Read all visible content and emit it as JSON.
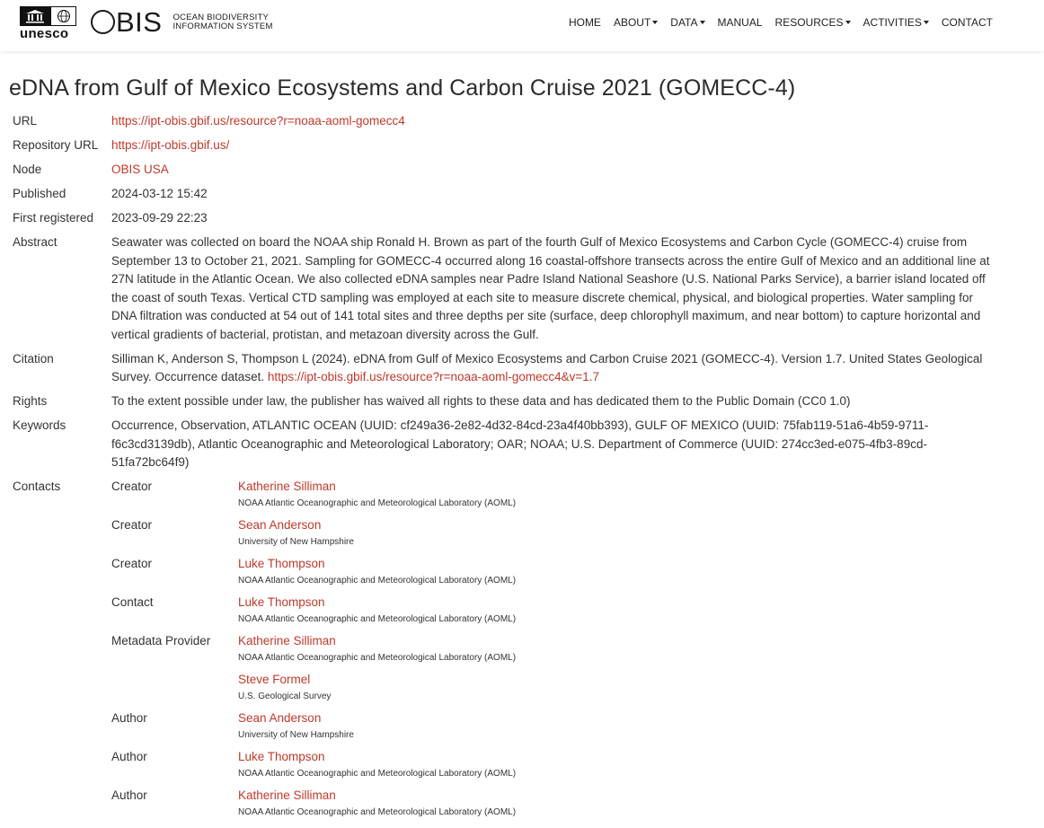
{
  "header": {
    "unesco_word": "unesco",
    "obis_word": "OBIS",
    "obis_sub_line1": "OCEAN BIODIVERSITY",
    "obis_sub_line2": "INFORMATION SYSTEM",
    "nav": [
      {
        "label": "HOME",
        "dropdown": false
      },
      {
        "label": "ABOUT",
        "dropdown": true
      },
      {
        "label": "DATA",
        "dropdown": true
      },
      {
        "label": "MANUAL",
        "dropdown": false
      },
      {
        "label": "RESOURCES",
        "dropdown": true
      },
      {
        "label": "ACTIVITIES",
        "dropdown": true
      },
      {
        "label": "CONTACT",
        "dropdown": false
      }
    ]
  },
  "title": "eDNA from Gulf of Mexico Ecosystems and Carbon Cruise 2021 (GOMECC-4)",
  "fields": {
    "url_label": "URL",
    "url": "https://ipt-obis.gbif.us/resource?r=noaa-aoml-gomecc4",
    "repo_label": "Repository URL",
    "repo": "https://ipt-obis.gbif.us/",
    "node_label": "Node",
    "node": "OBIS USA",
    "published_label": "Published",
    "published": "2024-03-12 15:42",
    "first_label": "First registered",
    "first": "2023-09-29 22:23",
    "abstract_label": "Abstract",
    "abstract": "Seawater was collected on board the NOAA ship Ronald H. Brown as part of the fourth Gulf of Mexico Ecosystems and Carbon Cycle (GOMECC-4) cruise from September 13 to October 21, 2021. Sampling for GOMECC-4 occurred along 16 coastal-offshore transects across the entire Gulf of Mexico and an additional line at 27N latitude in the Atlantic Ocean. We also collected eDNA samples near Padre Island National Seashore (U.S. National Parks Service), a barrier island located off the coast of south Texas. Vertical CTD sampling was employed at each site to measure discrete chemical, physical, and biological properties. Water sampling for DNA filtration was conducted at 54 out of 141 total sites and three depths per site (surface, deep chlorophyll maximum, and near bottom) to capture horizontal and vertical gradients of bacterial, protistan, and metazoan diversity across the Gulf.",
    "citation_label": "Citation",
    "citation_text": "Silliman K, Anderson S, Thompson L (2024). eDNA from Gulf of Mexico Ecosystems and Carbon Cruise 2021 (GOMECC-4). Version 1.7. United States Geological Survey. Occurrence dataset. ",
    "citation_link": "https://ipt-obis.gbif.us/resource?r=noaa-aoml-gomecc4&v=1.7",
    "rights_label": "Rights",
    "rights": "To the extent possible under law, the publisher has waived all rights to these data and has dedicated them to the Public Domain (CC0 1.0)",
    "keywords_label": "Keywords",
    "keywords": "Occurrence, Observation, ATLANTIC OCEAN (UUID: cf249a36-2e82-4d32-84cd-23a4f40bb393), GULF OF MEXICO (UUID: 75fab119-51a6-4b59-9711-f6c3cd3139db), Atlantic Oceanographic and Meteorological Laboratory; OAR; NOAA; U.S. Department of Commerce (UUID: 274cc3ed-e075-4fb3-89cd-51fa72bc64f9)",
    "contacts_label": "Contacts"
  },
  "contacts": [
    {
      "role": "Creator",
      "people": [
        {
          "name": "Katherine Silliman",
          "org": "NOAA Atlantic Oceanographic and Meteorological Laboratory (AOML)"
        }
      ]
    },
    {
      "role": "Creator",
      "people": [
        {
          "name": "Sean Anderson",
          "org": "University of New Hampshire"
        }
      ]
    },
    {
      "role": "Creator",
      "people": [
        {
          "name": "Luke Thompson",
          "org": "NOAA Atlantic Oceanographic and Meteorological Laboratory (AOML)"
        }
      ]
    },
    {
      "role": "Contact",
      "people": [
        {
          "name": "Luke Thompson",
          "org": "NOAA Atlantic Oceanographic and Meteorological Laboratory (AOML)"
        }
      ]
    },
    {
      "role": "Metadata Provider",
      "people": [
        {
          "name": "Katherine Silliman",
          "org": "NOAA Atlantic Oceanographic and Meteorological Laboratory (AOML)"
        },
        {
          "name": "Steve Formel",
          "org": "U.S. Geological Survey"
        }
      ]
    },
    {
      "role": "Author",
      "people": [
        {
          "name": "Sean Anderson",
          "org": "University of New Hampshire"
        }
      ]
    },
    {
      "role": "Author",
      "people": [
        {
          "name": "Luke Thompson",
          "org": "NOAA Atlantic Oceanographic and Meteorological Laboratory (AOML)"
        }
      ]
    },
    {
      "role": "Author",
      "people": [
        {
          "name": "Katherine Silliman",
          "org": "NOAA Atlantic Oceanographic and Meteorological Laboratory (AOML)"
        }
      ]
    }
  ],
  "colors": {
    "link": "#c0392b",
    "text": "#333333"
  }
}
